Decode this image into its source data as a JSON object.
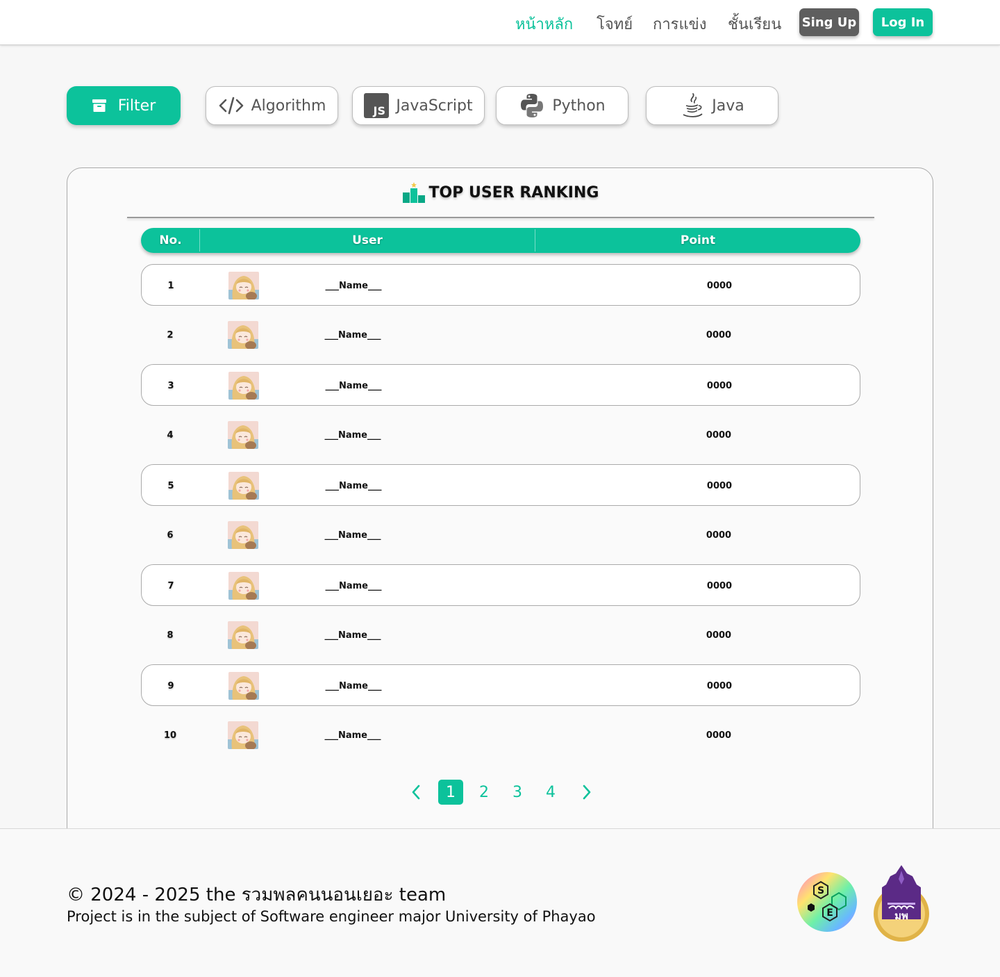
{
  "nav": {
    "links": [
      "หน้าหลัก",
      "โจทย์",
      "การแข่ง",
      "ชั้นเรียน"
    ],
    "signup_label": "Sing Up",
    "login_label": "Log In",
    "accent_color": "#0cc29b"
  },
  "filters": {
    "filter_label": "Filter",
    "chips": [
      "Algorithm",
      "JavaScript",
      "Python",
      "Java"
    ],
    "icons": [
      "archive-icon",
      "code-icon",
      "js-icon",
      "python-icon",
      "java-icon"
    ]
  },
  "ranking": {
    "title": "TOP USER RANKING",
    "columns": [
      "No.",
      "User",
      "Point"
    ],
    "rows": [
      {
        "no": "1",
        "name": "___Name___",
        "point": "0000"
      },
      {
        "no": "2",
        "name": "___Name___",
        "point": "0000"
      },
      {
        "no": "3",
        "name": "___Name___",
        "point": "0000"
      },
      {
        "no": "4",
        "name": "___Name___",
        "point": "0000"
      },
      {
        "no": "5",
        "name": "___Name___",
        "point": "0000"
      },
      {
        "no": "6",
        "name": "___Name___",
        "point": "0000"
      },
      {
        "no": "7",
        "name": "___Name___",
        "point": "0000"
      },
      {
        "no": "8",
        "name": "___Name___",
        "point": "0000"
      },
      {
        "no": "9",
        "name": "___Name___",
        "point": "0000"
      },
      {
        "no": "10",
        "name": "___Name___",
        "point": "0000"
      }
    ]
  },
  "pagination": {
    "pages": [
      "1",
      "2",
      "3",
      "4"
    ],
    "current": "1"
  },
  "footer": {
    "copyright": "© 2024 - 2025 the รวมพลคนนอนเยอะ team",
    "subtitle": "Project is in the subject of Software engineer major University of Phayao",
    "logo_letters": [
      "S",
      "E",
      "มพ"
    ]
  }
}
